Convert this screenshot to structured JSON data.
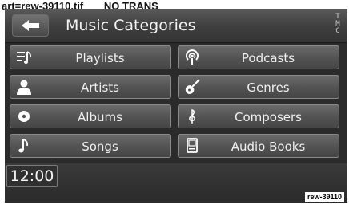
{
  "caption": {
    "left": "art=rew-39110.tif",
    "right": "NO TRANS"
  },
  "header": {
    "title": "Music Categories",
    "tmc_label": [
      "T",
      "M",
      "C"
    ]
  },
  "categories": [
    {
      "label": "Playlists",
      "icon": "playlist-icon"
    },
    {
      "label": "Podcasts",
      "icon": "podcast-icon"
    },
    {
      "label": "Artists",
      "icon": "artist-icon"
    },
    {
      "label": "Genres",
      "icon": "guitar-icon"
    },
    {
      "label": "Albums",
      "icon": "disc-icon"
    },
    {
      "label": "Composers",
      "icon": "treble-clef-icon"
    },
    {
      "label": "Songs",
      "icon": "music-note-icon"
    },
    {
      "label": "Audio Books",
      "icon": "book-icon"
    }
  ],
  "status": {
    "clock": "12:00",
    "ref_code": "rew-39110"
  },
  "colors": {
    "screen_bg": "#2b2b2b",
    "button_bg": "#545454",
    "text": "#f0f0f0"
  }
}
